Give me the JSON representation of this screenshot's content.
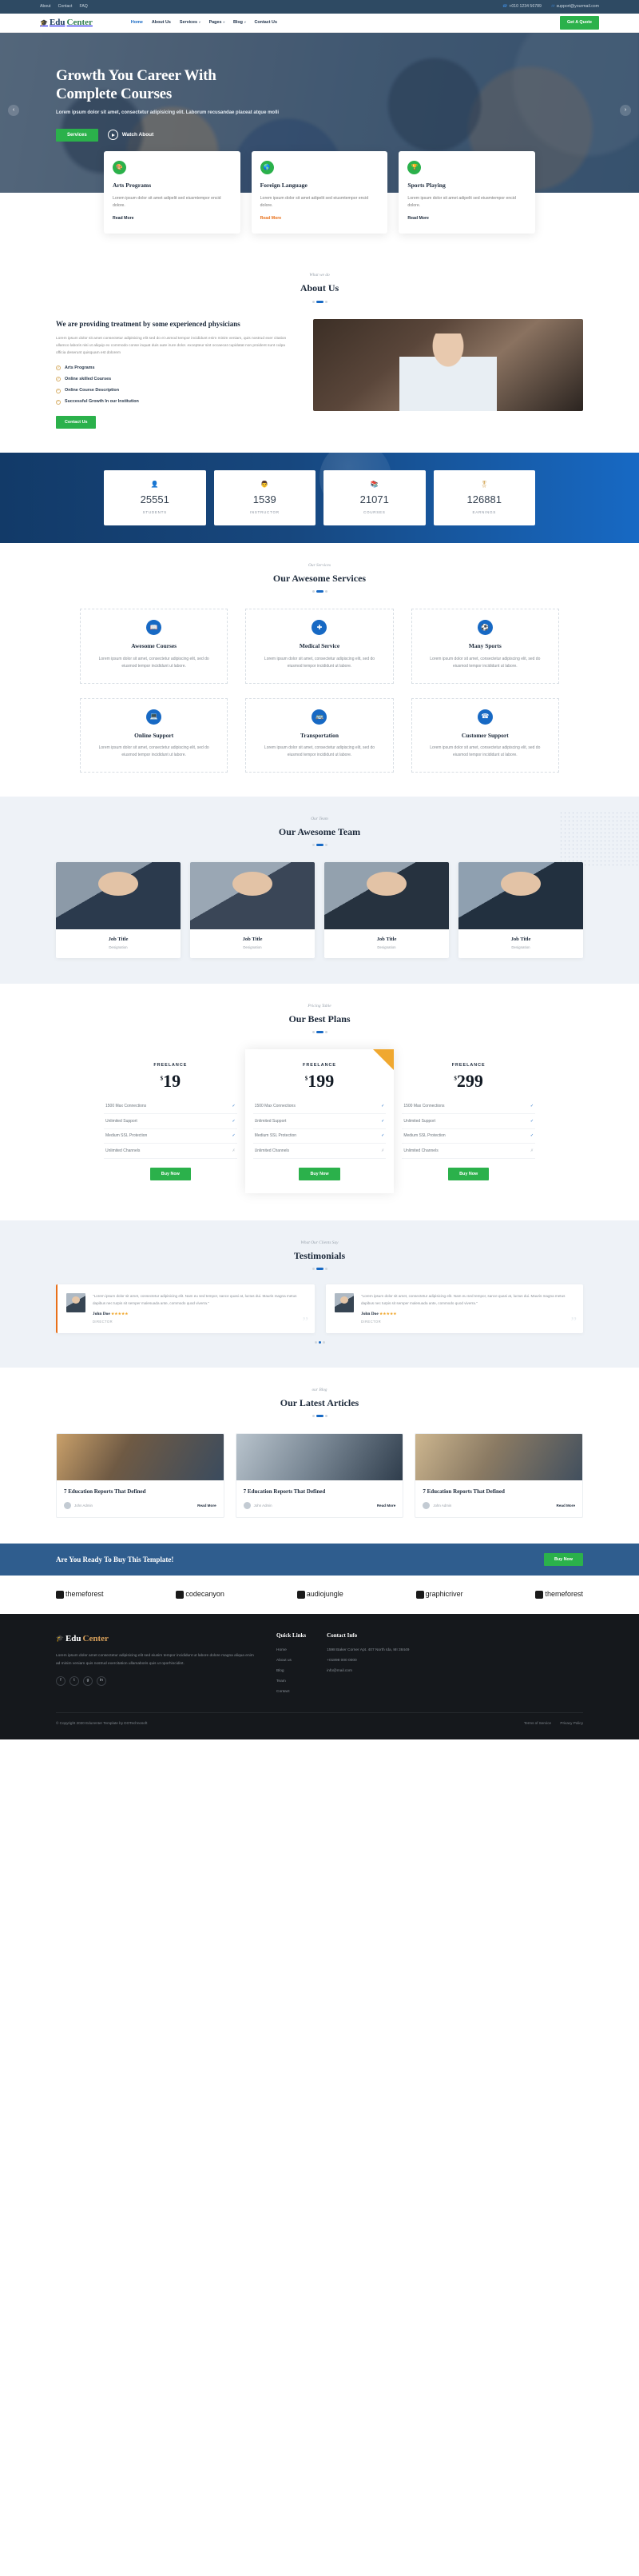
{
  "topbar": {
    "links": [
      "About",
      "Contact",
      "FAQ"
    ],
    "phone": "+010 1234 56789",
    "email": "support@yourmail.com",
    "phone_icon": "phone-icon",
    "mail_icon": "mail-icon"
  },
  "header": {
    "logo": {
      "cap": "⌂",
      "part1": "Edu",
      "part2": "Center"
    },
    "nav": [
      {
        "label": "Home",
        "caret": false
      },
      {
        "label": "About Us",
        "caret": false
      },
      {
        "label": "Services",
        "caret": true
      },
      {
        "label": "Pages",
        "caret": true
      },
      {
        "label": "Blog",
        "caret": true
      },
      {
        "label": "Contact Us",
        "caret": false
      }
    ],
    "quote_label": "Get A Quote"
  },
  "hero": {
    "title_line1": "Growth You Career With",
    "title_line2": "Complete Courses",
    "paragraph": "Lorem ipsum dolor sit amet, consectetur adipisicing elit. Laborum recusandae placeat atque molli",
    "btn_primary": "Services",
    "btn_watch": "Watch About",
    "prev_icon": "chevron-left-icon",
    "next_icon": "chevron-right-icon"
  },
  "features": [
    {
      "icon": "palette-icon",
      "title": "Arts Programs",
      "text": "Lorem ipsum dolor sit amet adipelit sed eiusmtempor encid dolore.",
      "link": "Read More",
      "link_style": "dark"
    },
    {
      "icon": "globe-icon",
      "title": "Foreign Language",
      "text": "Lorem ipsum dolor sit amet adipelit sed eiusmtempor encid dolore.",
      "link": "Read More",
      "link_style": "orange"
    },
    {
      "icon": "trophy-icon",
      "title": "Sports Playing",
      "text": "Lorem ipsum dolor sit amet adipelit sed eiusmtempor encid dolore.",
      "link": "Read More",
      "link_style": "dark"
    }
  ],
  "about": {
    "sub": "What we do",
    "title": "About Us",
    "heading": "We are providing treatment by some experienced physicians",
    "paragraph": "Lorem ipsum dolor sit amet consectetur adipisicing elit sed do ei usmod tempor incididunt enim minim veniam, quis nostrud exer citation ullamco laboris nisi ut aliquip ex commodo conse inquat duis aute irure dolor. excepteur sint occaecat cupidatat non proident sunt culpa officia deserunt quisquam est dolorem",
    "list": [
      "Arts Programs",
      "Online skilled Courses",
      "Online Course Description",
      "Successful Growth In our Institution"
    ],
    "button": "Contact Us"
  },
  "counters": [
    {
      "icon": "user-icon",
      "value": "25551",
      "label": "STUDENTS"
    },
    {
      "icon": "teacher-icon",
      "value": "1539",
      "label": "INSTRUCTOR"
    },
    {
      "icon": "book-icon",
      "value": "21071",
      "label": "COURSES"
    },
    {
      "icon": "award-icon",
      "value": "126881",
      "label": "EARNINGS"
    }
  ],
  "services": {
    "sub": "Our Services",
    "title": "Our Awesome Services",
    "items": [
      {
        "icon": "book-icon",
        "title": "Awesome Courses",
        "text": "Lorem ipsum dolor sit amet, consectetur adipiscing elit, sed do eiusmod tempor incididunt ut labore."
      },
      {
        "icon": "plus-icon",
        "title": "Medical Service",
        "text": "Lorem ipsum dolor sit amet, consectetur adipiscing elit, sed do eiusmod tempor incididunt ut labore."
      },
      {
        "icon": "ball-icon",
        "title": "Many Sports",
        "text": "Lorem ipsum dolor sit amet, consectetur adipiscing elit, sed do eiusmod tempor incididunt ut labore."
      },
      {
        "icon": "monitor-icon",
        "title": "Online Support",
        "text": "Lorem ipsum dolor sit amet, consectetur adipiscing elit, sed do eiusmod tempor incididunt ut labore."
      },
      {
        "icon": "bus-icon",
        "title": "Transportation",
        "text": "Lorem ipsum dolor sit amet, consectetur adipiscing elit, sed do eiusmod tempor incididunt ut labore."
      },
      {
        "icon": "headset-icon",
        "title": "Customer Support",
        "text": "Lorem ipsum dolor sit amet, consectetur adipiscing elit, sed do eiusmod tempor incididunt ut labore."
      }
    ]
  },
  "team": {
    "sub": "Our Team",
    "title": "Our Awesome Team",
    "members": [
      {
        "name": "Job Title",
        "role": "Designation"
      },
      {
        "name": "Job Title",
        "role": "Designation"
      },
      {
        "name": "Job Title",
        "role": "Designation"
      },
      {
        "name": "Job Title",
        "role": "Designation"
      }
    ]
  },
  "pricing": {
    "sub": "Pricing Table",
    "title": "Our Best Plans",
    "plans": [
      {
        "label": "FREELANCE",
        "currency": "$",
        "price": "19",
        "featured": false,
        "ribbon": false,
        "features": [
          {
            "text": "1500 Max Connections",
            "ok": true
          },
          {
            "text": "Unlimited Support",
            "ok": true
          },
          {
            "text": "Medium SSL Protection",
            "ok": true
          },
          {
            "text": "Unlimited Channels",
            "ok": false
          }
        ],
        "button": "Buy Now"
      },
      {
        "label": "FREELANCE",
        "currency": "$",
        "price": "199",
        "featured": true,
        "ribbon": true,
        "features": [
          {
            "text": "1500 Max Connections",
            "ok": true
          },
          {
            "text": "Unlimited Support",
            "ok": true
          },
          {
            "text": "Medium SSL Protection",
            "ok": true
          },
          {
            "text": "Unlimited Channels",
            "ok": false
          }
        ],
        "button": "Buy Now"
      },
      {
        "label": "FREELANCE",
        "currency": "$",
        "price": "299",
        "featured": false,
        "ribbon": false,
        "features": [
          {
            "text": "1500 Max Connections",
            "ok": true
          },
          {
            "text": "Unlimited Support",
            "ok": true
          },
          {
            "text": "Medium SSL Protection",
            "ok": true
          },
          {
            "text": "Unlimited Channels",
            "ok": false
          }
        ],
        "button": "Buy Now"
      }
    ]
  },
  "testimonials": {
    "sub": "What Our Clients Say",
    "title": "Testimonials",
    "items": [
      {
        "quote": "\"Lorem ipsum dolor sit amet, consectetur adipisicing elit. Nam eu sed tempor, sance quasi at, luctus dui. Mauris magna metus dapibus nec turpis sit semper malesuada ante, commodo quod viverra.\"",
        "name": "John Doe",
        "role": "DIRECTOR",
        "stars": "★★★★★",
        "active": true
      },
      {
        "quote": "\"Lorem ipsum dolor sit amet, consectetur adipisicing elit. Nam eu sed tempor, sance quasi at, luctus dui. Mauris magna metus dapibus nec turpis sit semper malesuada ante, commodo quod viverra.\"",
        "name": "John Doe",
        "role": "DIRECTOR",
        "stars": "★★★★★",
        "active": false
      }
    ]
  },
  "blog": {
    "sub": "our Blog",
    "title": "Our Latest Articles",
    "posts": [
      {
        "title": "7 Education Reports That Defined",
        "author": "John Admin",
        "read": "Read More"
      },
      {
        "title": "7 Education Reports That Defined",
        "author": "John Admin",
        "read": "Read More"
      },
      {
        "title": "7 Education Reports That Defined",
        "author": "John Admin",
        "read": "Read More"
      }
    ]
  },
  "cta": {
    "title": "Are You Ready To Buy This Template!",
    "button": "Buy Now"
  },
  "brands": [
    {
      "name": "themeforest",
      "icon": "themeforest-icon"
    },
    {
      "name": "codecanyon",
      "icon": "codecanyon-icon"
    },
    {
      "name": "audiojungle",
      "icon": "audiojungle-icon"
    },
    {
      "name": "graphicriver",
      "icon": "graphicriver-icon"
    },
    {
      "name": "themeforest",
      "icon": "themeforest-icon"
    }
  ],
  "footer": {
    "logo": {
      "cap": "⌂",
      "part1": "Edu",
      "part2": "Center"
    },
    "about": "Lorem ipsum dolor amet consectetur adipisicing elit sed eiusim tempor incididunt ut labore dolore magna aliqua enim ad minim veniam quis nostrud exercitation ullamaboris quis ut oporhincidint.",
    "socials": [
      "f",
      "t",
      "g",
      "in"
    ],
    "quick_links_title": "Quick Links",
    "quick_links": [
      "Home",
      "About us",
      "Blog",
      "Team",
      "Contact"
    ],
    "contact_title": "Contact Info",
    "contact": [
      "1598 Baker Corner Apt. 407 North Ida, MI 38449",
      "+01898 000 0000",
      "info@mail.com"
    ],
    "copyright": "© Copyright 2020 Eduzenter Template by DOTechnosoft",
    "bottom_links": [
      "Terms of Service",
      "Privacy Policy"
    ]
  }
}
